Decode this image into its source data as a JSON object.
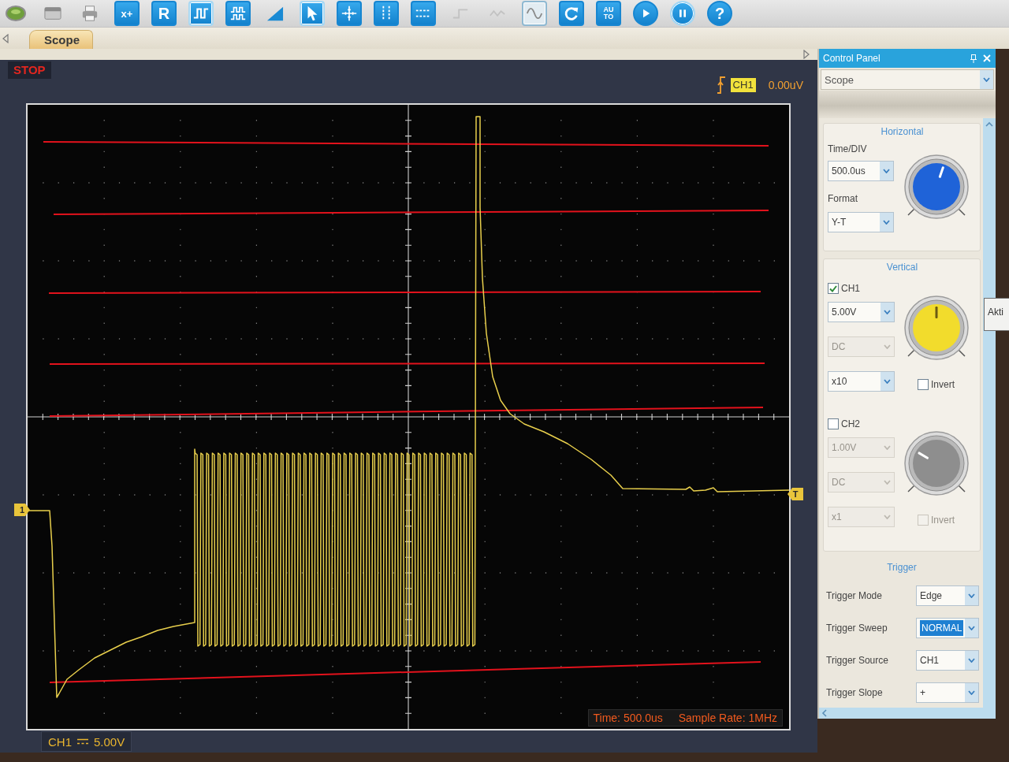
{
  "toolbar": [
    {
      "kind": "disc",
      "selected": false,
      "disabled": false
    },
    {
      "kind": "window",
      "selected": false,
      "disabled": false
    },
    {
      "kind": "printer",
      "selected": false,
      "disabled": false
    },
    {
      "kind": "label",
      "label": "x+",
      "selected": false,
      "disabled": false
    },
    {
      "kind": "label",
      "label": "R",
      "selected": false,
      "disabled": false
    },
    {
      "kind": "pulse",
      "selected": true,
      "disabled": false
    },
    {
      "kind": "dual_pulse",
      "selected": false,
      "disabled": false
    },
    {
      "kind": "ramp",
      "selected": false,
      "disabled": false
    },
    {
      "kind": "cursor",
      "selected": true,
      "disabled": false
    },
    {
      "kind": "crosshair",
      "selected": false,
      "disabled": false
    },
    {
      "kind": "vertical_cursors",
      "selected": false,
      "disabled": false
    },
    {
      "kind": "horizontal_cursors",
      "selected": false,
      "disabled": false
    },
    {
      "kind": "step",
      "selected": false,
      "disabled": true
    },
    {
      "kind": "wave",
      "selected": false,
      "disabled": true
    },
    {
      "kind": "sine",
      "selected": true,
      "disabled": false
    },
    {
      "kind": "refresh",
      "selected": false,
      "disabled": false
    },
    {
      "kind": "label",
      "label": "AUTO",
      "selected": false,
      "disabled": false
    },
    {
      "kind": "play",
      "selected": false,
      "disabled": false
    },
    {
      "kind": "pause",
      "selected": true,
      "disabled": false
    },
    {
      "kind": "help",
      "label": "?",
      "selected": false,
      "disabled": false
    }
  ],
  "tabs": [
    {
      "label": "Scope",
      "selected": true
    }
  ],
  "scope": {
    "status": "STOP",
    "trigger_channel": "CH1",
    "trigger_level": "0.00uV",
    "channel_marker": "1",
    "trigger_marker": "T",
    "time_base": "Time: 500.0us",
    "sample_rate": "Sample Rate: 1MHz",
    "readout_channel": "CH1",
    "readout_scale": "5.00V"
  },
  "control_panel": {
    "title": "Control Panel",
    "mode": "Scope",
    "horizontal": {
      "title": "Horizontal",
      "time_div_label": "Time/DIV",
      "time_div": "500.0us",
      "format_label": "Format",
      "format": "Y-T",
      "knob": {
        "level": 0.57
      }
    },
    "vertical": {
      "title": "Vertical",
      "channels": [
        {
          "label": "CH1",
          "checked": true,
          "color": "#f2dc2c",
          "knob": {
            "level": 0.5
          },
          "scale": {
            "value": "5.00V",
            "disabled": false
          },
          "coupling": {
            "value": "DC",
            "disabled": true
          },
          "probe": {
            "value": "x10",
            "disabled": false
          },
          "invert": {
            "label": "Invert",
            "checked": false,
            "disabled": false
          }
        },
        {
          "label": "CH2",
          "checked": false,
          "color": "#8e8e8e",
          "knob": {
            "level": 0.28
          },
          "scale": {
            "value": "1.00V",
            "disabled": true
          },
          "coupling": {
            "value": "DC",
            "disabled": true
          },
          "probe": {
            "value": "x1",
            "disabled": true
          },
          "invert": {
            "label": "Invert",
            "checked": false,
            "disabled": true
          }
        }
      ]
    },
    "trigger": {
      "title": "Trigger",
      "rows": [
        {
          "label": "Trigger Mode",
          "value": "Edge",
          "focused": false
        },
        {
          "label": "Trigger Sweep",
          "value": "NORMAL",
          "focused": true
        },
        {
          "label": "Trigger Source",
          "value": "CH1",
          "focused": false
        },
        {
          "label": "Trigger Slope",
          "value": "+",
          "focused": false
        }
      ]
    }
  },
  "tooltip": "Akti"
}
